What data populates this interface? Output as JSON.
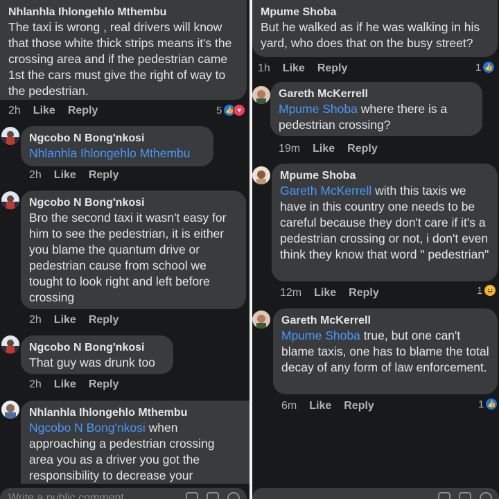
{
  "left": {
    "c1": {
      "author": "Nhlanhla Ihlongehlo Mthembu",
      "text": "The taxi is wrong , real drivers will know that those white thick strips means it's the crossing area and if the pedestrian came 1st the cars must give the right of way to the pedestrian.",
      "time": "2h",
      "like": "Like",
      "reply": "Reply",
      "reactions": "5"
    },
    "c2": {
      "author": "Ngcobo N Bong'nkosi",
      "mention": "Nhlanhla Ihlongehlo Mthembu",
      "time": "2h",
      "like": "Like",
      "reply": "Reply"
    },
    "c3": {
      "author": "Ngcobo N Bong'nkosi",
      "text": "Bro the second taxi it wasn't easy for him to see the pedestrian, it is either you blame the quantum drive or pedestrian cause from school we tought to look right and left before crossing",
      "time": "2h",
      "like": "Like",
      "reply": "Reply"
    },
    "c4": {
      "author": "Ngcobo N Bong'nkosi",
      "text": "That guy was drunk too",
      "time": "2h",
      "like": "Like",
      "reply": "Reply"
    },
    "c5": {
      "author": "Nhlanhla Ihlongehlo Mthembu",
      "mention": "Ngcobo N Bong'nkosi",
      "text": " when approaching a pedestrian crossing area you as a driver you got the responsibility to decrease your"
    },
    "composer_placeholder": "Write a public comment..."
  },
  "right": {
    "c1": {
      "author": "Mpume Shoba",
      "text": "But he walked as if he was walking in his yard, who does that on the busy street?",
      "time": "1h",
      "like": "Like",
      "reply": "Reply",
      "reactions": "1"
    },
    "c2": {
      "author": "Gareth McKerrell",
      "mention": "Mpume Shoba",
      "text": " where there is a pedestrian crossing?",
      "time": "19m",
      "like": "Like",
      "reply": "Reply"
    },
    "c3": {
      "author": "Mpume Shoba",
      "mention": "Gareth McKerrell",
      "text": " with this taxis we have in this country one needs to be careful because they don't care if it's a pedestrian crossing or not, i don't even think they know that word \" pedestrian\"",
      "time": "12m",
      "like": "Like",
      "reply": "Reply",
      "reactions": "1"
    },
    "c4": {
      "author": "Gareth McKerrell",
      "mention": "Mpume Shoba",
      "text": " true, but one can't blame taxis, one has to blame the total decay of any form of law enforcement.",
      "time": "6m",
      "like": "Like",
      "reply": "Reply",
      "reactions": "1"
    }
  },
  "colors": {
    "bg": "#18191a",
    "bubble": "#3a3b3c",
    "mention": "#4599ff",
    "like": "#1877f2",
    "love": "#f33e58",
    "haha": "#f7b125"
  }
}
